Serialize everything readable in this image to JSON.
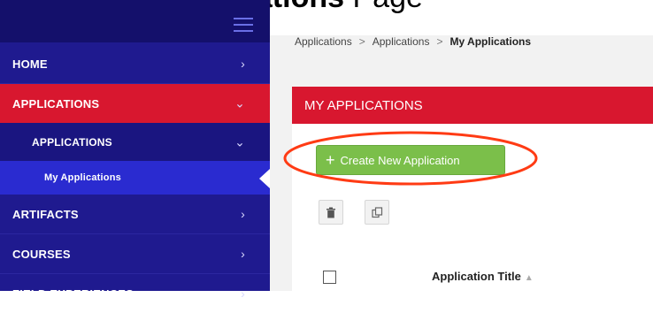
{
  "caption": {
    "text_bold": "Applications",
    "text_regular": " Page"
  },
  "sidebar": {
    "items": [
      {
        "label": "HOME",
        "chevron": "›"
      },
      {
        "label": "APPLICATIONS",
        "chevron": "⌄"
      },
      {
        "label": "APPLICATIONS",
        "chevron": "⌄"
      },
      {
        "label": "My Applications"
      },
      {
        "label": "ARTIFACTS",
        "chevron": "›"
      },
      {
        "label": "COURSES",
        "chevron": "›"
      },
      {
        "label": "FIELD EXPERIENCES",
        "chevron": "›"
      }
    ]
  },
  "breadcrumb": {
    "items": [
      "Applications",
      "Applications",
      "My Applications"
    ],
    "separator": ">"
  },
  "panel": {
    "title": "MY APPLICATIONS",
    "create_button": {
      "icon": "+",
      "label": "Create New Application"
    },
    "table": {
      "column_title": "Application Title",
      "sort_indicator": "▲"
    }
  },
  "colors": {
    "sidebar": "#1f1a8f",
    "sidebar_top": "#14106b",
    "active": "#d8172f",
    "sub_active": "#2a2bd0",
    "create_button": "#7bbf4a",
    "highlight": "#ff3b14"
  }
}
